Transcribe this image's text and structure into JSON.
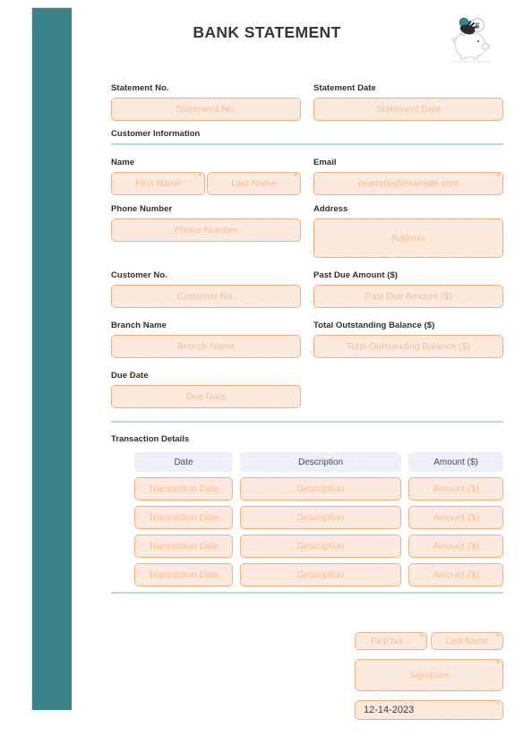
{
  "header": {
    "title": "BANK STATEMENT",
    "logo_icon": "piggy-bank-coin-icon"
  },
  "top_fields": {
    "statement_no": {
      "label": "Statement No.",
      "placeholder": "Statement No."
    },
    "statement_date": {
      "label": "Statement Date",
      "placeholder": "Statement Date"
    }
  },
  "sections": {
    "customer_information": "Customer Information",
    "transaction_details": "Transaction Details"
  },
  "customer": {
    "name": {
      "label": "Name",
      "first_placeholder": "First Name",
      "last_placeholder": "Last Name",
      "required_marker": "*"
    },
    "email": {
      "label": "Email",
      "placeholder": "example@example.com",
      "required_marker": "*"
    },
    "phone": {
      "label": "Phone Number",
      "placeholder": "Phone Number"
    },
    "address": {
      "label": "Address",
      "placeholder": "Address"
    },
    "customer_no": {
      "label": "Customer No.",
      "placeholder": "Customer No."
    },
    "past_due_amount": {
      "label": "Past Due Amount ($)",
      "placeholder": "Past Due Amount ($)"
    },
    "branch_name": {
      "label": "Branch Name",
      "placeholder": "Branch Name"
    },
    "total_outstanding_balance": {
      "label": "Total Outstanding Balance ($)",
      "placeholder": "Total Outstanding Balance ($)"
    },
    "due_date": {
      "label": "Due Date",
      "placeholder": "Due Date"
    }
  },
  "transactions": {
    "headers": [
      "Date",
      "Description",
      "Amount ($)"
    ],
    "rows": [
      {
        "date": "Transaction Date",
        "description": "Description",
        "amount": "Amount ($)"
      },
      {
        "date": "Transaction Date",
        "description": "Description",
        "amount": "Amount ($)"
      },
      {
        "date": "Transaction Date",
        "description": "Description",
        "amount": "Amount ($)"
      },
      {
        "date": "Transaction Date",
        "description": "Description",
        "amount": "Amount ($)"
      }
    ]
  },
  "footer": {
    "first_name": {
      "placeholder": "First Na…",
      "required_marker": "*"
    },
    "last_name": {
      "placeholder": "Last Name",
      "required_marker": "*"
    },
    "signature": {
      "placeholder": "Signature",
      "required_marker": "*"
    },
    "date": {
      "value": "12-14-2023",
      "required_marker": "*"
    }
  },
  "colors": {
    "sidebar_teal": "#3a8389",
    "field_border": "#f2b183",
    "field_fill": "#fdeade",
    "placeholder_text": "#f7bd95",
    "divider_mint": "#a9e2dc",
    "table_header_fill": "#eef1f7",
    "title_text": "#36363a"
  }
}
